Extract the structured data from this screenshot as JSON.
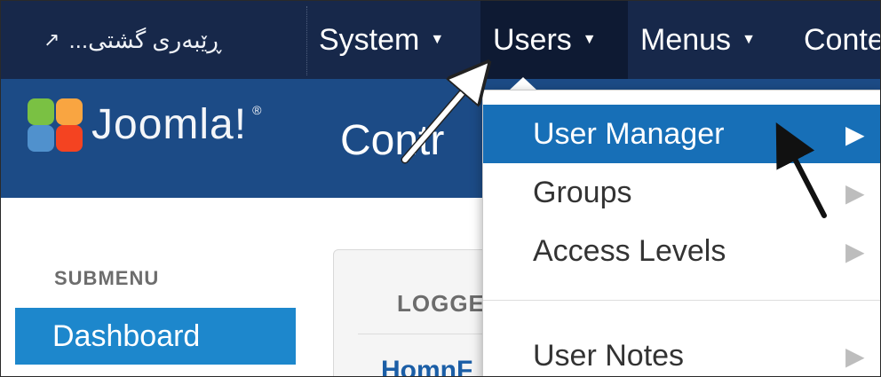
{
  "topnav": {
    "site_link_label": "...ڕێبەری گشتی",
    "site_link_icon": "external-link-icon",
    "items": [
      {
        "label": "System",
        "icon": "caret-down-icon"
      },
      {
        "label": "Users",
        "icon": "caret-down-icon"
      },
      {
        "label": "Menus",
        "icon": "caret-down-icon"
      },
      {
        "label": "Conte"
      }
    ]
  },
  "header": {
    "logo_text": "Joomla!",
    "page_title": "Contr"
  },
  "sidebar": {
    "heading": "SUBMENU",
    "items": [
      {
        "label": "Dashboard",
        "active": true
      }
    ]
  },
  "panel": {
    "title": "LOGGE",
    "link": "HomnF"
  },
  "dropdown": {
    "items": [
      {
        "label": "User Manager",
        "icon": "chevron-right-icon",
        "active": true
      },
      {
        "label": "Groups",
        "icon": "chevron-right-icon"
      },
      {
        "label": "Access Levels",
        "icon": "chevron-right-icon"
      },
      {
        "label": "User Notes",
        "icon": "chevron-right-icon"
      }
    ]
  },
  "colors": {
    "nav_bg": "#17284a",
    "header_bg": "#1c4b86",
    "accent_blue": "#1d87cc",
    "dropdown_active": "#176fb7"
  }
}
